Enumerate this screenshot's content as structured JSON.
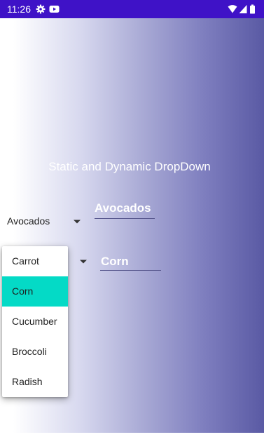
{
  "status_bar": {
    "time": "11:26",
    "left_icons": [
      "gear-icon",
      "youtube-icon"
    ],
    "right_icons": [
      "wifi-icon",
      "signal-icon",
      "battery-icon"
    ],
    "color": "#3f12c7"
  },
  "screen": {
    "title": "Static and Dynamic DropDown"
  },
  "static_dropdown": {
    "value": "Avocados",
    "selected_label": "Avocados"
  },
  "dynamic_dropdown": {
    "selected_label": "Corn",
    "popup": {
      "options": [
        {
          "label": "Carrot",
          "selected": false
        },
        {
          "label": "Corn",
          "selected": true
        },
        {
          "label": "Cucumber",
          "selected": false
        },
        {
          "label": "Broccoli",
          "selected": false
        },
        {
          "label": "Radish",
          "selected": false
        }
      ],
      "highlight_color": "#04dac6"
    }
  }
}
